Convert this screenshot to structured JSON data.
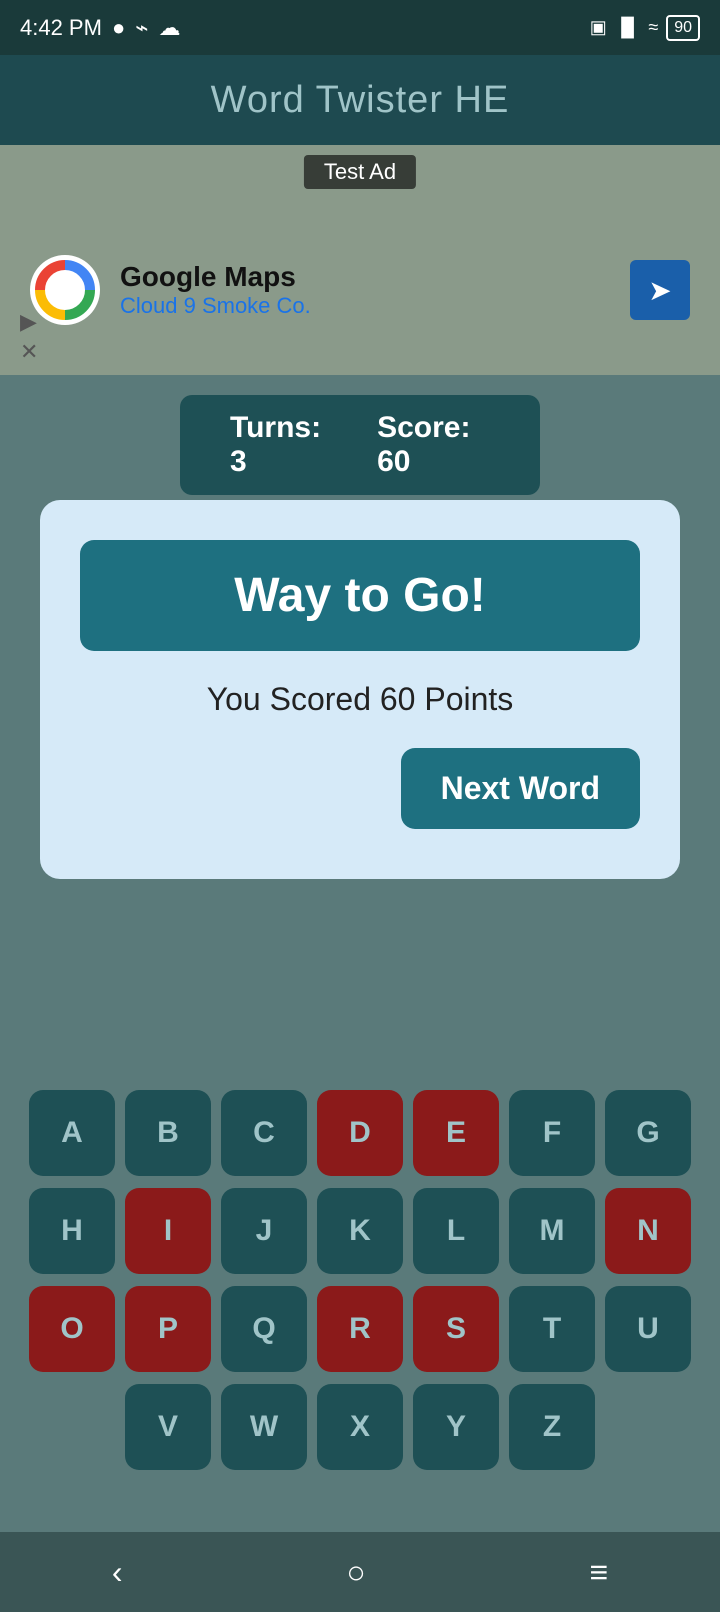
{
  "statusBar": {
    "time": "4:42 PM",
    "battery": "90"
  },
  "header": {
    "title": "Word Twister HE"
  },
  "ad": {
    "label": "Test Ad",
    "appName": "Google Maps",
    "business": "Cloud 9 Smoke Co."
  },
  "scoreBar": {
    "turnsLabel": "Turns:",
    "turnsValue": "3",
    "scoreLabel": "Score:",
    "scoreValue": "60"
  },
  "modal": {
    "banner": "Way to Go!",
    "scoreText": "You Scored 60 Points",
    "nextWordLabel": "Next Word"
  },
  "keyboard": {
    "rows": [
      [
        "A",
        "B",
        "C",
        "D",
        "E",
        "F",
        "G"
      ],
      [
        "H",
        "I",
        "J",
        "K",
        "L",
        "M",
        "N"
      ],
      [
        "O",
        "P",
        "Q",
        "R",
        "S",
        "T",
        "U"
      ],
      [
        "V",
        "W",
        "X",
        "Y",
        "Z"
      ]
    ],
    "usedKeys": [
      "D",
      "E",
      "I",
      "N",
      "O",
      "P",
      "R",
      "S"
    ]
  },
  "navBar": {
    "backIcon": "‹",
    "homeIcon": "○",
    "menuIcon": "≡"
  }
}
